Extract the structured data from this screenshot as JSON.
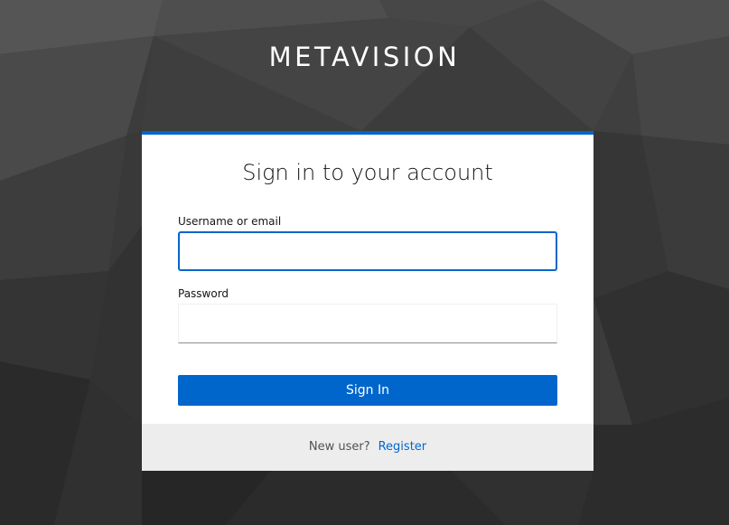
{
  "brand": {
    "title": "METAVISION"
  },
  "login": {
    "heading": "Sign in to your account",
    "username_label": "Username or email",
    "username_value": "",
    "password_label": "Password",
    "password_value": "",
    "submit_label": "Sign In"
  },
  "footer": {
    "new_user_text": "New user?",
    "register_label": "Register"
  },
  "colors": {
    "accent": "#0066cc",
    "background": "#3a3a3a",
    "footer_background": "#ededed"
  }
}
